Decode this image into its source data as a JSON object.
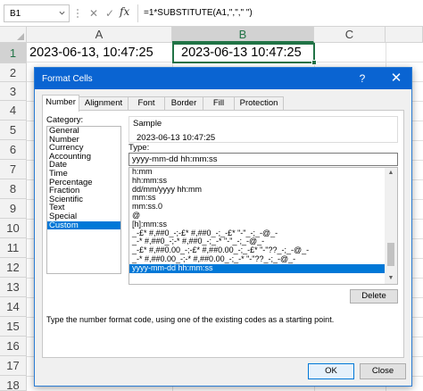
{
  "formula_bar": {
    "name_box": "B1",
    "cancel_icon": "cross-icon",
    "enter_icon": "check-icon",
    "fx_label": "fx",
    "formula": "=1*SUBSTITUTE(A1,\",\",\" \")"
  },
  "sheet": {
    "columns": [
      "A",
      "B",
      "C"
    ],
    "rows": [
      "1",
      "2",
      "3",
      "4",
      "5",
      "6",
      "7",
      "8",
      "9",
      "10",
      "11",
      "12",
      "13",
      "14",
      "15",
      "16",
      "17",
      "18"
    ],
    "cells": {
      "A1": "2023-06-13, 10:47:25",
      "B1": "2023-06-13 10:47:25"
    },
    "selected_cell": "B1",
    "accent_color": "#217346"
  },
  "dialog": {
    "title": "Format Cells",
    "help_label": "?",
    "close_label": "✕",
    "titlebar_color": "#0a64d2",
    "tabs": [
      "Number",
      "Alignment",
      "Font",
      "Border",
      "Fill",
      "Protection"
    ],
    "active_tab": "Number",
    "category_label": "Category:",
    "categories": [
      "General",
      "Number",
      "Currency",
      "Accounting",
      "Date",
      "Time",
      "Percentage",
      "Fraction",
      "Scientific",
      "Text",
      "Special",
      "Custom"
    ],
    "selected_category": "Custom",
    "sample_label": "Sample",
    "sample_value": "2023-06-13 10:47:25",
    "type_label": "Type:",
    "type_value": "yyyy-mm-dd hh:mm:ss",
    "type_list": [
      "h:mm",
      "hh:mm:ss",
      "dd/mm/yyyy hh:mm",
      "mm:ss",
      "mm:ss.0",
      "@",
      "[h]:mm:ss",
      "_-£* #,##0_-;-£* #,##0_-;_-£* \"-\"_-;_-@_-",
      "_-* #,##0_-;-* #,##0_-;_-* \"-\"_-;_-@_-",
      "_-£* #,##0.00_-;-£* #,##0.00_-;_-£* \"-\"??_-;_-@_-",
      "_-* #,##0.00_-;-* #,##0.00_-;_-* \"-\"??_-;_-@_-",
      "yyyy-mm-dd hh:mm:ss"
    ],
    "selected_type": "yyyy-mm-dd hh:mm:ss",
    "delete_label": "Delete",
    "hint": "Type the number format code, using one of the existing codes as a starting point.",
    "ok_label": "OK",
    "cancel_label": "Close",
    "selection_color": "#0078d7"
  }
}
